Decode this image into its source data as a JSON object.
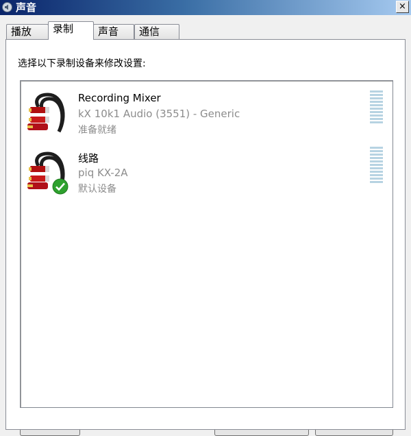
{
  "window": {
    "title": "声音",
    "close_glyph": "×"
  },
  "tabs": [
    {
      "label": "播放"
    },
    {
      "label": "录制"
    },
    {
      "label": "声音"
    },
    {
      "label": "通信"
    }
  ],
  "active_tab": "录制",
  "instruction": "选择以下录制设备来修改设置:",
  "devices": [
    {
      "name": "Recording Mixer",
      "driver": "kX 10k1 Audio (3551) - Generic",
      "status": "准备就绪",
      "icon": "audio-cable-icon",
      "default": false
    },
    {
      "name": "线路",
      "driver": "piq KX-2A",
      "status": "默认设备",
      "icon": "audio-cable-icon",
      "default": true
    }
  ],
  "colors": {
    "title_bar_start": "#0a246a",
    "title_bar_end": "#a6caf0",
    "meter": "#b7d3e2",
    "default_check": "#2ea12e",
    "secondary_text": "#8c8c8c"
  }
}
